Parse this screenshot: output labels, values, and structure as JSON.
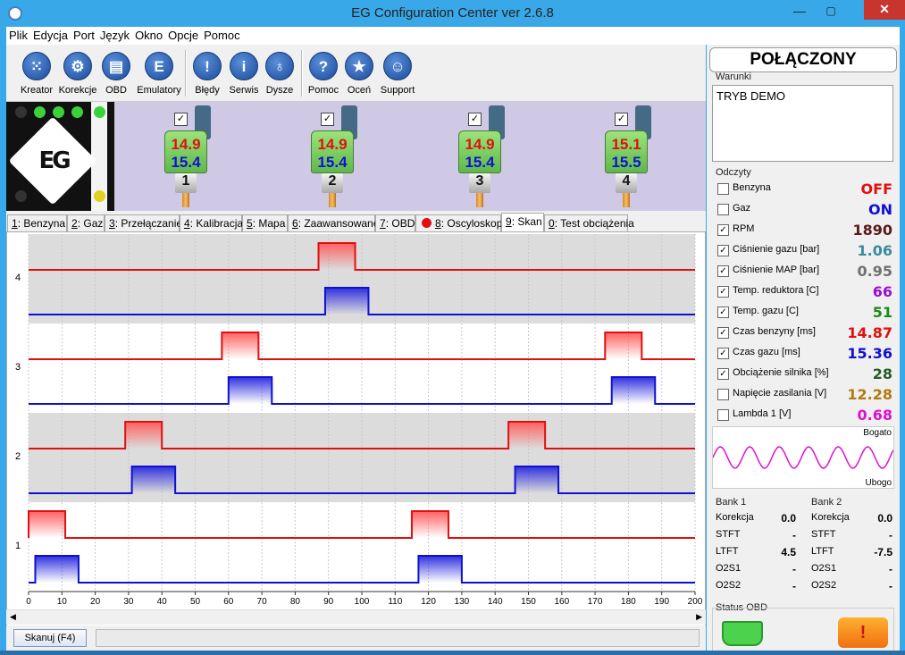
{
  "window": {
    "title": "EG Configuration Center ver 2.6.8",
    "minimize": "—",
    "maximize": "▢",
    "close": "✕"
  },
  "menu": [
    "Plik",
    "Edycja",
    "Port",
    "Język",
    "Okno",
    "Opcje",
    "Pomoc"
  ],
  "toolbar": [
    {
      "label": "Kreator",
      "icon": "grid-icon",
      "glyph": "⁙"
    },
    {
      "label": "Korekcje",
      "icon": "gear-icon",
      "glyph": "⚙"
    },
    {
      "label": "OBD",
      "icon": "obd-connector-icon",
      "glyph": "▤"
    },
    {
      "label": "Emulatory",
      "icon": "emulator-icon",
      "glyph": "E"
    },
    {
      "label": "Błędy",
      "icon": "error-icon",
      "glyph": "!"
    },
    {
      "label": "Serwis",
      "icon": "info-icon",
      "glyph": "i"
    },
    {
      "label": "Dysze",
      "icon": "nozzle-icon",
      "glyph": "♁"
    },
    {
      "label": "Pomoc",
      "icon": "help-icon",
      "glyph": "?"
    },
    {
      "label": "Oceń",
      "icon": "star-icon",
      "glyph": "★"
    },
    {
      "label": "Support",
      "icon": "support-icon",
      "glyph": "☺"
    }
  ],
  "logo": {
    "text": "EG"
  },
  "injectors": [
    {
      "petrol": "14.9",
      "gas": "15.4",
      "number": "1",
      "check": "✓"
    },
    {
      "petrol": "14.9",
      "gas": "15.4",
      "number": "2",
      "check": "✓"
    },
    {
      "petrol": "14.9",
      "gas": "15.4",
      "number": "3",
      "check": "✓"
    },
    {
      "petrol": "15.1",
      "gas": "15.5",
      "number": "4",
      "check": "✓"
    }
  ],
  "tabs": [
    {
      "key": "1",
      "label": ": Benzyna"
    },
    {
      "key": "2",
      "label": ": Gaz"
    },
    {
      "key": "3",
      "label": ": Przełączanie"
    },
    {
      "key": "4",
      "label": ": Kalibracja"
    },
    {
      "key": "5",
      "label": ": Mapa"
    },
    {
      "key": "6",
      "label": ": Zaawansowane"
    },
    {
      "key": "7",
      "label": ": OBD"
    },
    {
      "key": "8",
      "label": ": Oscyloskop"
    },
    {
      "key": "9",
      "label": ": Skan"
    },
    {
      "key": "0",
      "label": ": Test obciążenia"
    }
  ],
  "active_tab": "9",
  "chart_data": {
    "type": "line",
    "x_ticks": [
      0,
      10,
      20,
      30,
      40,
      50,
      60,
      70,
      80,
      90,
      100,
      110,
      120,
      130,
      140,
      150,
      160,
      170,
      180,
      190,
      200
    ],
    "xlim": [
      0,
      200
    ],
    "rows": [
      {
        "label": "4",
        "petrol_pulses": [
          [
            87,
            98
          ]
        ],
        "gas_pulses": [
          [
            89,
            102
          ]
        ]
      },
      {
        "label": "3",
        "petrol_pulses": [
          [
            58,
            69
          ],
          [
            173,
            184
          ]
        ],
        "gas_pulses": [
          [
            60,
            73
          ],
          [
            175,
            188
          ]
        ]
      },
      {
        "label": "2",
        "petrol_pulses": [
          [
            29,
            40
          ],
          [
            144,
            155
          ]
        ],
        "gas_pulses": [
          [
            31,
            44
          ],
          [
            146,
            159
          ]
        ]
      },
      {
        "label": "1",
        "petrol_pulses": [
          [
            0,
            11
          ],
          [
            115,
            126
          ]
        ],
        "gas_pulses": [
          [
            2,
            15
          ],
          [
            117,
            130
          ]
        ]
      }
    ],
    "colors": {
      "petrol": "#e01010",
      "gas": "#1010d0",
      "band": "#dcdcdc"
    }
  },
  "bottom": {
    "scan_button": "Skanuj (F4)"
  },
  "right": {
    "status": "POŁĄCZONY",
    "warunki_title": "Warunki",
    "warunki_text": "TRYB DEMO",
    "odczyty_title": "Odczyty",
    "readings": [
      {
        "label": "Benzyna",
        "value": "OFF",
        "color": "#e01010",
        "checked": false
      },
      {
        "label": "Gaz",
        "value": "ON",
        "color": "#1010d0",
        "checked": false
      },
      {
        "label": "RPM",
        "value": "1890",
        "color": "#5a1a1a",
        "checked": true
      },
      {
        "label": "Ciśnienie gazu [bar]",
        "value": "1.06",
        "color": "#3a8aa0",
        "checked": true
      },
      {
        "label": "Ciśnienie MAP [bar]",
        "value": "0.95",
        "color": "#707070",
        "checked": true
      },
      {
        "label": "Temp. reduktora [C]",
        "value": "66",
        "color": "#9a10d0",
        "checked": true
      },
      {
        "label": "Temp. gazu [C]",
        "value": "51",
        "color": "#1a8a1a",
        "checked": true
      },
      {
        "label": "Czas benzyny [ms]",
        "value": "14.87",
        "color": "#e01010",
        "checked": true
      },
      {
        "label": "Czas gazu [ms]",
        "value": "15.36",
        "color": "#1010d0",
        "checked": true
      },
      {
        "label": "Obciążenie silnika [%]",
        "value": "28",
        "color": "#2a5a2a",
        "checked": true
      },
      {
        "label": "Napięcie zasilania [V]",
        "value": "12.28",
        "color": "#b07a10",
        "checked": false
      },
      {
        "label": "Lambda 1 [V]",
        "value": "0.68",
        "color": "#e010d0",
        "checked": false
      }
    ],
    "lambda_rich": "Bogato",
    "lambda_lean": "Ubogo",
    "bank1": {
      "title": "Bank 1",
      "rows": [
        [
          "Korekcja",
          "0.0"
        ],
        [
          "STFT",
          "-"
        ],
        [
          "LTFT",
          "4.5"
        ],
        [
          "O2S1",
          "-"
        ],
        [
          "O2S2",
          "-"
        ]
      ]
    },
    "bank2": {
      "title": "Bank 2",
      "rows": [
        [
          "Korekcja",
          "0.0"
        ],
        [
          "STFT",
          "-"
        ],
        [
          "LTFT",
          "-7.5"
        ],
        [
          "O2S1",
          "-"
        ],
        [
          "O2S2",
          "-"
        ]
      ]
    },
    "obd_title": "Status OBD"
  }
}
